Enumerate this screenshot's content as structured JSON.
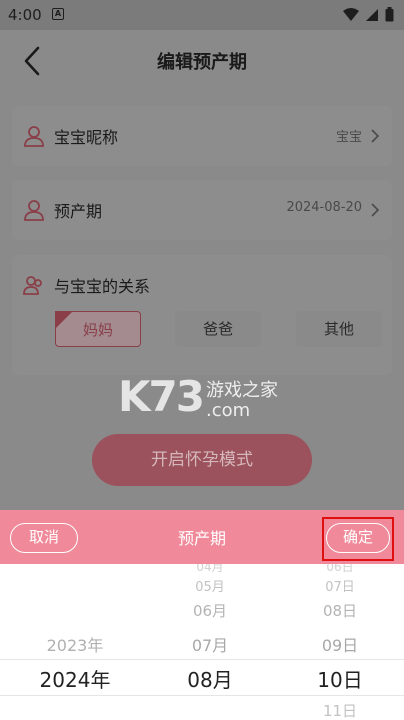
{
  "status": {
    "time": "4:00",
    "badge": "A"
  },
  "header": {
    "title": "编辑预产期"
  },
  "rows": [
    {
      "label": "宝宝昵称",
      "value": "宝宝",
      "icon": "person-icon"
    },
    {
      "label": "预产期",
      "value": "2024-08-20",
      "icon": "person-icon"
    }
  ],
  "relation": {
    "title": "与宝宝的关系",
    "options": [
      "妈妈",
      "爸爸",
      "其他"
    ],
    "selected": "妈妈"
  },
  "watermark": {
    "brand": "K73",
    "cn": "游戏之家",
    "domain": ".com"
  },
  "start_button": "开启怀孕模式",
  "toolbar": {
    "cancel": "取消",
    "title": "预产期",
    "confirm": "确定"
  },
  "picker": {
    "years": [
      "2023年",
      "2024年"
    ],
    "months": [
      "05月",
      "06月",
      "07月",
      "08月"
    ],
    "days": [
      "07日",
      "08日",
      "09日",
      "10日",
      "11日"
    ],
    "top_partial_day": "06日",
    "top_partial_month": "04月"
  },
  "colors": {
    "accent": "#f08a9a",
    "selected_text": "#8a3e48",
    "highlight": "#e01010"
  }
}
